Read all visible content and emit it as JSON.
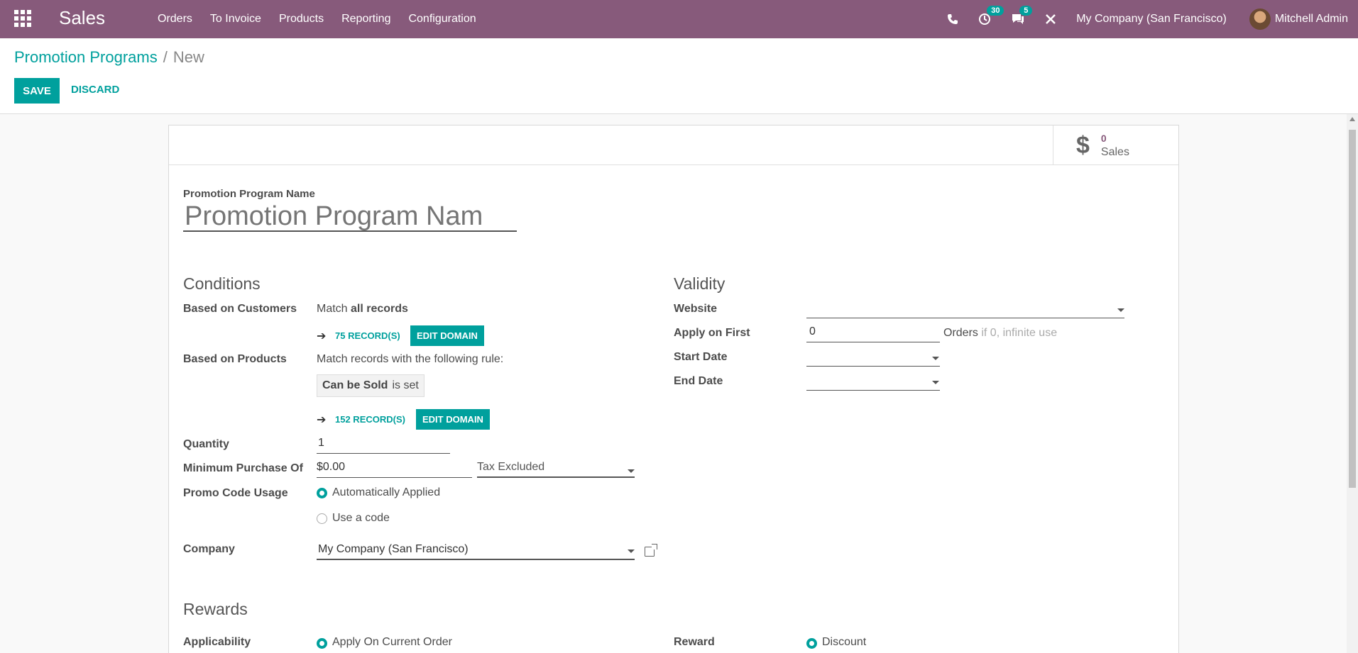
{
  "navbar": {
    "app_title": "Sales",
    "menu": [
      "Orders",
      "To Invoice",
      "Products",
      "Reporting",
      "Configuration"
    ],
    "activity_count": "30",
    "message_count": "5",
    "company": "My Company (San Francisco)",
    "user": "Mitchell Admin",
    "icons": [
      "apps-icon",
      "phone-icon",
      "clock-icon",
      "chat-icon",
      "close-icon"
    ]
  },
  "control_panel": {
    "breadcrumb_parent": "Promotion Programs",
    "breadcrumb_sep": "/",
    "breadcrumb_current": "New",
    "save_label": "SAVE",
    "discard_label": "DISCARD"
  },
  "stat_button": {
    "value": "0",
    "label": "Sales",
    "icon": "dollar-icon"
  },
  "form": {
    "name_label": "Promotion Program Name",
    "name_placeholder": "Promotion Program Nam",
    "conditions": {
      "title": "Conditions",
      "customers_label": "Based on Customers",
      "customers_match_prefix": "Match ",
      "customers_match_bold": "all records",
      "customers_records": "75 RECORD(S)",
      "edit_domain": "EDIT DOMAIN",
      "products_label": "Based on Products",
      "products_match": "Match records with the following rule:",
      "rule_field": "Can be Sold",
      "rule_op": "is set",
      "products_records": "152 RECORD(S)",
      "quantity_label": "Quantity",
      "quantity_value": "1",
      "min_purchase_label": "Minimum Purchase Of",
      "min_purchase_value": "$0.00",
      "tax_value": "Tax Excluded",
      "promo_usage_label": "Promo Code Usage",
      "promo_opt1": "Automatically Applied",
      "promo_opt2": "Use a code",
      "company_label": "Company",
      "company_value": "My Company (San Francisco)"
    },
    "validity": {
      "title": "Validity",
      "website_label": "Website",
      "website_value": "",
      "apply_first_label": "Apply on First",
      "apply_first_value": "0",
      "orders_label": "Orders",
      "orders_hint": "if 0, infinite use",
      "start_label": "Start Date",
      "end_label": "End Date"
    },
    "rewards": {
      "title": "Rewards",
      "applicability_label": "Applicability",
      "applicability_value": "Apply On Current Order",
      "reward_label": "Reward",
      "reward_value": "Discount"
    }
  },
  "colors": {
    "primary": "#00a09d",
    "navbar": "#875a7b"
  }
}
